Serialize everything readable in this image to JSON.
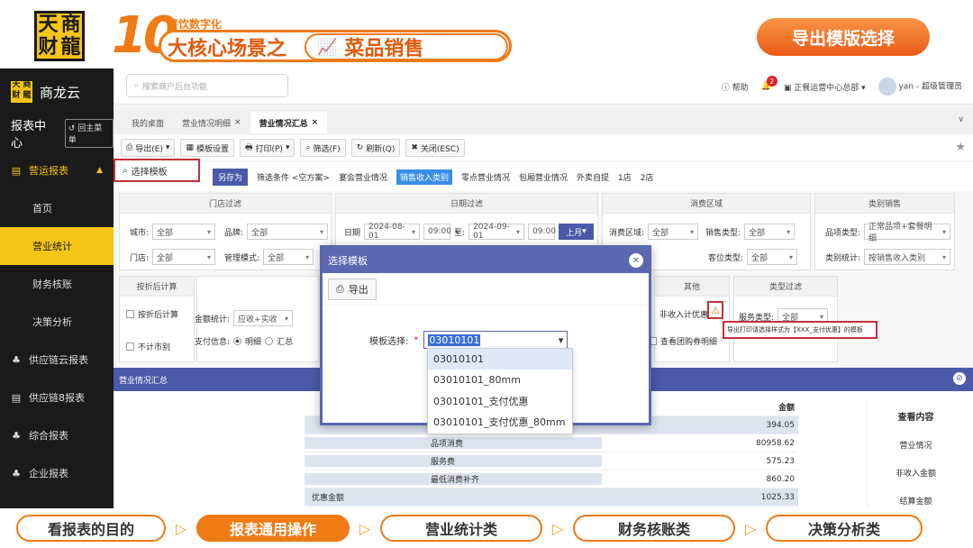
{
  "banner": {
    "logo_chars": [
      "天",
      "商",
      "财",
      "龍"
    ],
    "ten": "10",
    "sub": "餐饮数字化",
    "main": "大核心场景之",
    "dish": "菜品销售",
    "export_choice": "导出模版选择"
  },
  "sidebar": {
    "brand": "商龙云",
    "center": "报表中心",
    "back": "回主菜单",
    "items": [
      {
        "label": "营运报表",
        "icon": "report-icon"
      },
      {
        "label": "首页"
      },
      {
        "label": "营业统计"
      },
      {
        "label": "财务核账"
      },
      {
        "label": "决策分析"
      },
      {
        "label": "供应链云报表",
        "icon": "tree-icon"
      },
      {
        "label": "供应链8报表",
        "icon": "report-icon"
      },
      {
        "label": "综合报表",
        "icon": "tree-icon"
      },
      {
        "label": "企业报表",
        "icon": "tree-icon"
      }
    ]
  },
  "header": {
    "search_placeholder": "搜索商户后台功能",
    "help": "帮助",
    "notif_count": "2",
    "org": "正餐运营中心总部",
    "user": "yan - 超级管理员"
  },
  "tabs": [
    {
      "label": "我的桌面"
    },
    {
      "label": "营业情况明细"
    },
    {
      "label": "营业情况汇总"
    }
  ],
  "toolbar": {
    "export": "导出(E)",
    "template_settings": "模板设置",
    "print": "打印(P)",
    "filter": "筛选(F)",
    "refresh": "刷新(Q)",
    "close": "关闭(ESC)",
    "select_template": "选择模板"
  },
  "filterbar": {
    "save_as": "另存为",
    "cond": "筛选条件 <空方案>",
    "items": [
      "宴会营业情况",
      "销售收入类别",
      "零点营业情况",
      "包厢营业情况",
      "外卖自提",
      "1店",
      "2店"
    ]
  },
  "panel": {
    "store_filter": "门店过滤",
    "date_filter": "日期过滤",
    "consume_area": "消费区域",
    "category_sales": "类别销售",
    "city": "城市:",
    "brand_l": "品牌:",
    "store": "门店:",
    "mgmt": "管理模式:",
    "all": "全部",
    "date": "日期",
    "date_from": "2024-08-01",
    "time_from": "09:00",
    "to": "至:",
    "date_to": "2024-09-01",
    "time_to": "09:00",
    "month": "上月",
    "area_l": "消费区域:",
    "sales_type": "销售类型:",
    "guest_type": "客位类型:",
    "item_type": "品项类型:",
    "item_type_val": "正常品项+套餐明细",
    "cat_stats": "类别统计:",
    "cat_stats_val": "按销售收入类别",
    "post_calc": "按折后计算",
    "post_calc_cb": "按折后计算",
    "no_market": "不计市别",
    "amount_stats": "金额统计:",
    "amount_val": "应收+实收",
    "pay_info": "支付信息:",
    "detail": "明细",
    "summary": "汇总",
    "other": "其他",
    "non_income": "非收入计优惠",
    "groupon": "查看团购券明细",
    "type_filter": "类型过滤",
    "service_type": "服务类型:",
    "tooltip": "导出打印请选择样式为【XXX_支付优惠】的模板"
  },
  "report": {
    "title": "营业情况汇总",
    "col_amount": "金额",
    "rows": [
      {
        "label": "",
        "value": "394.05"
      },
      {
        "label": "品项消费",
        "value": "80958.62"
      },
      {
        "label": "服务费",
        "value": "575.23"
      },
      {
        "label": "最低消费补齐",
        "value": "860.20"
      },
      {
        "label": "优惠金额",
        "value": "1025.33"
      }
    ],
    "side_title": "查看内容",
    "side_items": [
      "营业情况",
      "非收入金额",
      "结算金额"
    ]
  },
  "dialog": {
    "title": "选择模板",
    "export": "导出",
    "label": "模板选择:",
    "value": "03010101",
    "options": [
      "03010101",
      "03010101_80mm",
      "03010101_支付优惠",
      "03010101_支付优惠_80mm"
    ]
  },
  "bottomnav": [
    "看报表的目的",
    "报表通用操作",
    "营业统计类",
    "财务核账类",
    "决策分析类"
  ],
  "colors": {
    "accent": "#f07a14",
    "primary": "#4a5aa8",
    "highlight": "#c5303a",
    "sidebar": "#1a1a1a"
  }
}
